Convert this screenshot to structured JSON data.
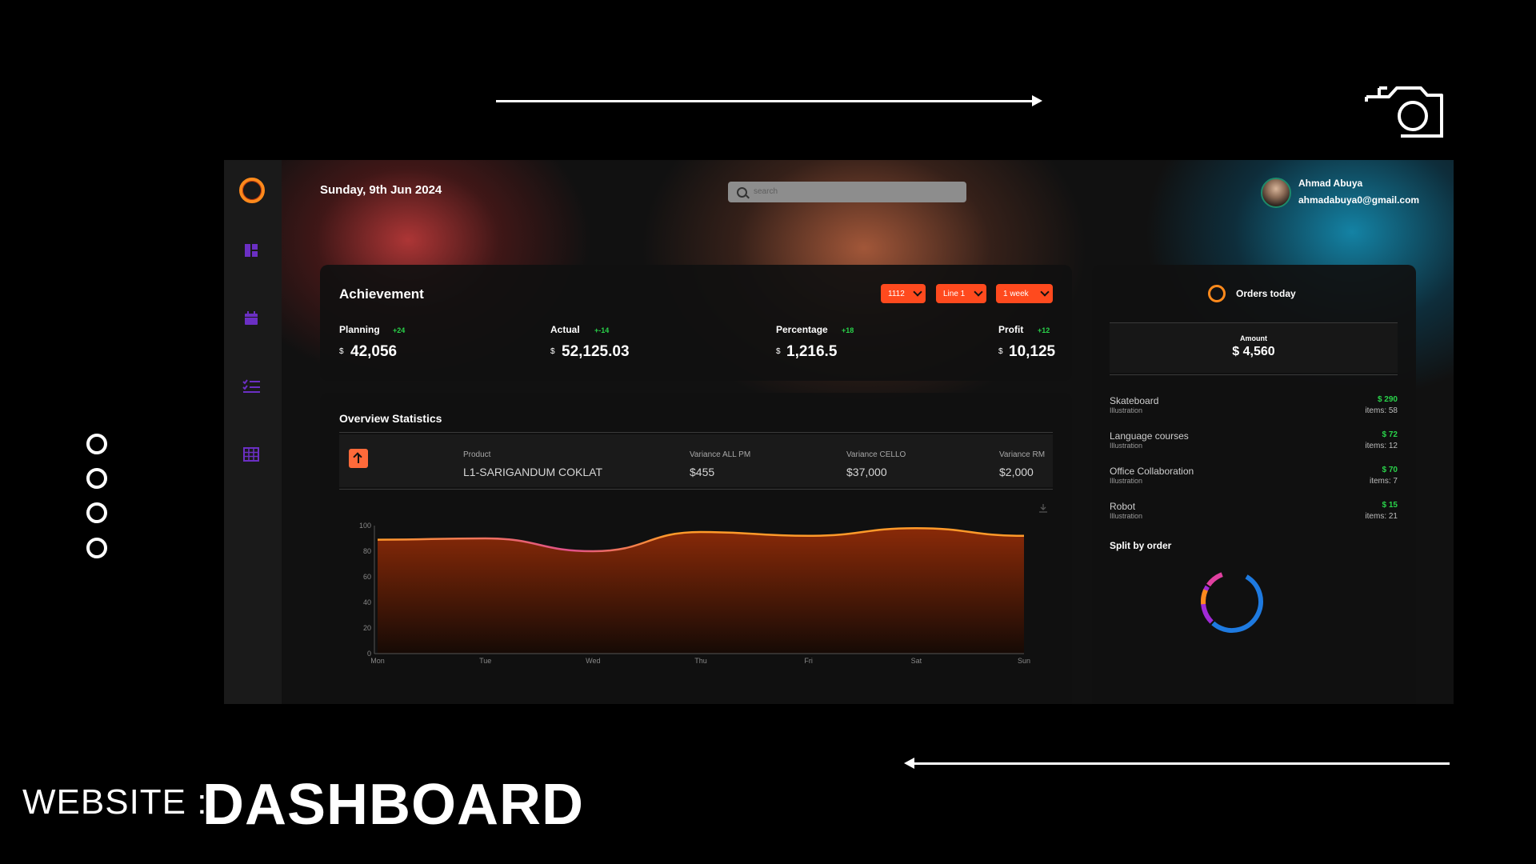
{
  "caption": {
    "prefix": "WEBSITE :",
    "title": "DASHBOARD"
  },
  "header": {
    "date": "Sunday, 9th Jun 2024",
    "search_placeholder": "search",
    "user": {
      "name": "Ahmad Abuya",
      "email": "ahmadabuya0@gmail.com"
    }
  },
  "sidebar": {
    "icons": [
      "dashboard-icon",
      "calendar-icon",
      "checklist-icon",
      "table-icon"
    ],
    "accent": "#6b2fc4"
  },
  "achievement": {
    "title": "Achievement",
    "filters": [
      "1112",
      "Line 1",
      "1 week"
    ],
    "stats": [
      {
        "label": "Planning",
        "delta": "+24",
        "currency": "$",
        "value": "42,056"
      },
      {
        "label": "Actual",
        "delta": "+-14",
        "currency": "$",
        "value": "52,125.03"
      },
      {
        "label": "Percentage",
        "delta": "+18",
        "currency": "$",
        "value": "1,216.5"
      },
      {
        "label": "Profit",
        "delta": "+12",
        "currency": "$",
        "value": "10,125"
      }
    ]
  },
  "overview": {
    "title": "Overview Statistics",
    "columns": [
      {
        "head": "Product",
        "value": "L1-SARIGANDUM COKLAT"
      },
      {
        "head": "Variance ALL PM",
        "value": "$455"
      },
      {
        "head": "Variance CELLO",
        "value": "$37,000"
      },
      {
        "head": "Variance RM",
        "value": "$2,000"
      }
    ]
  },
  "chart_data": {
    "type": "area",
    "x": [
      "Mon",
      "Tue",
      "Wed",
      "Thu",
      "Fri",
      "Sat",
      "Sun"
    ],
    "series": [
      {
        "values": [
          89,
          90,
          80,
          95,
          92,
          98,
          92
        ]
      }
    ],
    "ylim": [
      0,
      100
    ],
    "yticks": [
      0,
      20,
      40,
      60,
      80,
      100
    ],
    "grid": false,
    "colors": {
      "fill_top": "#8a2a08",
      "fill_bottom": "#160a05",
      "line_warm": "#ff9a2a",
      "line_pink": "#e0508a"
    }
  },
  "orders": {
    "title": "Orders today",
    "amount_label": "Amount",
    "amount_value": "$ 4,560",
    "items": [
      {
        "name": "Skateboard",
        "sub": "Illustration",
        "price": "$ 290",
        "count": "items: 58"
      },
      {
        "name": "Language courses",
        "sub": "Illustration",
        "price": "$ 72",
        "count": "items: 12"
      },
      {
        "name": "Office Collaboration",
        "sub": "Illustration",
        "price": "$ 70",
        "count": "items: 7"
      },
      {
        "name": "Robot",
        "sub": "Illustration",
        "price": "$ 15",
        "count": "items: 21"
      }
    ],
    "split_title": "Split by order",
    "split_colors": [
      "#1e7ae0",
      "#a12ad6",
      "#ff8a1c",
      "#e040a0"
    ]
  }
}
